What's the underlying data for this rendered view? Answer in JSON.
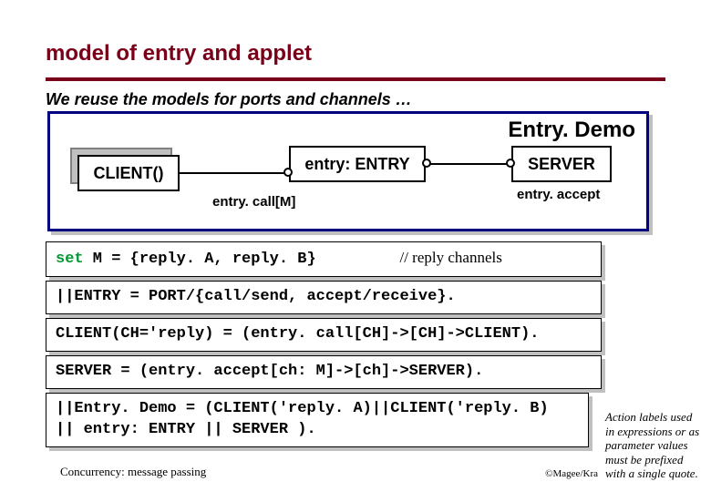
{
  "title": "model of entry and applet",
  "subtitle": "We reuse the models for ports and channels …",
  "diagram": {
    "title": "Entry. Demo",
    "client": "CLIENT()",
    "entry": "entry: ENTRY",
    "server": "SERVER",
    "call_label": "entry. call[M]",
    "accept_label": "entry. accept"
  },
  "code": {
    "line1_pre": "set",
    "line1_rest": " M = {reply. A, reply. B}",
    "line1_comment": "// reply channels",
    "line2": "||ENTRY = PORT/{call/send, accept/receive}.",
    "line3": "CLIENT(CH='reply) = (entry. call[CH]->[CH]->CLIENT).",
    "line4": "SERVER = (entry. accept[ch: M]->[ch]->SERVER).",
    "line5a": "||Entry. Demo = (CLIENT('reply. A)||CLIENT('reply. B)",
    "line5b": "             || entry: ENTRY || SERVER  )."
  },
  "note": "Action labels used in expressions or as parameter values must be prefixed with a single quote.",
  "footer": "Concurrency: message passing",
  "copyright": "©Magee/Kra"
}
